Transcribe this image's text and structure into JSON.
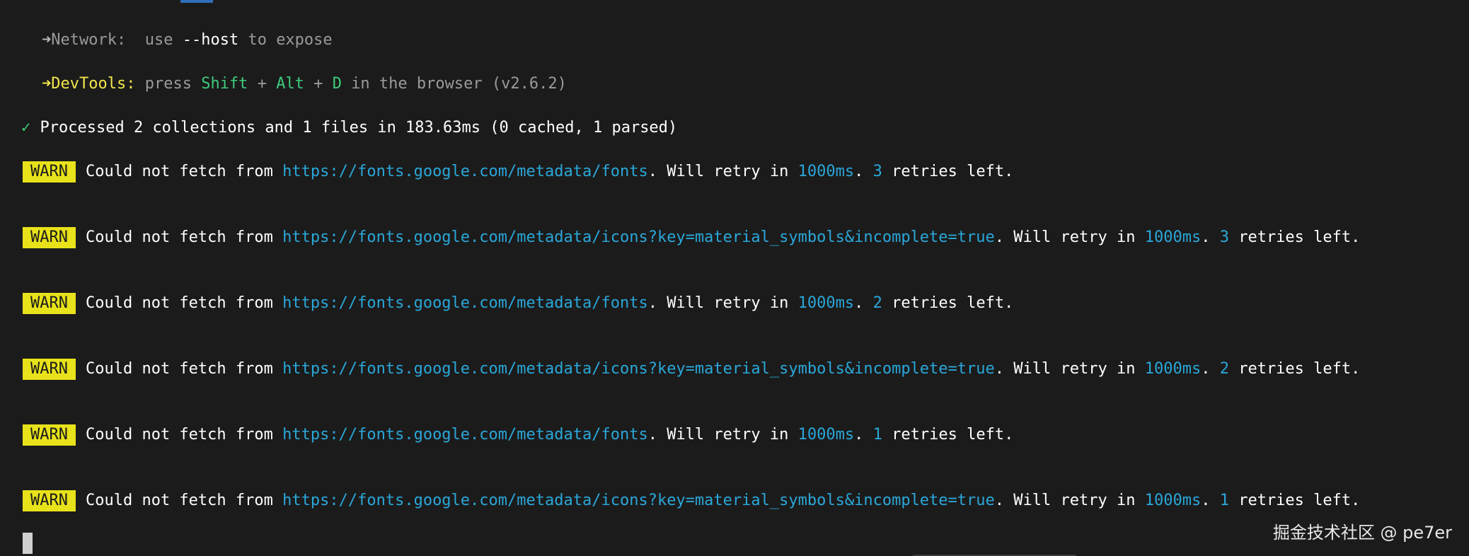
{
  "network": {
    "arrow": "➜",
    "label": "Network:",
    "use": "use",
    "flag": "--host",
    "rest": "to expose"
  },
  "devtools": {
    "arrow": "➜",
    "label": "DevTools:",
    "press": "press",
    "shift": "Shift",
    "plus1": "+",
    "alt": "Alt",
    "plus2": "+",
    "d": "D",
    "rest": "in the browser (v2.6.2)"
  },
  "processed": {
    "check": "✓",
    "text": "Processed 2 collections and 1 files in 183.63ms (0 cached, 1 parsed)"
  },
  "warnings": [
    {
      "badge": "WARN",
      "prefix": "Could not fetch from",
      "url": "https://fonts.google.com/metadata/fonts",
      "mid": ". Will retry in",
      "ms": "1000ms",
      "dot": ".",
      "count": "3",
      "suffix": "retries left."
    },
    {
      "badge": "WARN",
      "prefix": "Could not fetch from",
      "url": "https://fonts.google.com/metadata/icons?key=material_symbols&incomplete=true",
      "mid": ". Will retry in",
      "ms": "1000ms",
      "dot": ".",
      "count": "3",
      "suffix": "retries left."
    },
    {
      "badge": "WARN",
      "prefix": "Could not fetch from",
      "url": "https://fonts.google.com/metadata/fonts",
      "mid": ". Will retry in",
      "ms": "1000ms",
      "dot": ".",
      "count": "2",
      "suffix": "retries left."
    },
    {
      "badge": "WARN",
      "prefix": "Could not fetch from",
      "url": "https://fonts.google.com/metadata/icons?key=material_symbols&incomplete=true",
      "mid": ". Will retry in",
      "ms": "1000ms",
      "dot": ".",
      "count": "2",
      "suffix": "retries left."
    },
    {
      "badge": "WARN",
      "prefix": "Could not fetch from",
      "url": "https://fonts.google.com/metadata/fonts",
      "mid": ". Will retry in",
      "ms": "1000ms",
      "dot": ".",
      "count": "1",
      "suffix": "retries left."
    },
    {
      "badge": "WARN",
      "prefix": "Could not fetch from",
      "url": "https://fonts.google.com/metadata/icons?key=material_symbols&incomplete=true",
      "mid": ". Will retry in",
      "ms": "1000ms",
      "dot": ".",
      "count": "1",
      "suffix": "retries left."
    }
  ],
  "watermark": "掘金技术社区 @ pe7er",
  "colors": {
    "background": "#1b1b1b",
    "warn_badge": "#e8e21a",
    "url": "#2aa7d9",
    "devtools_label": "#f2e64a",
    "key_green": "#3ecb7b"
  }
}
